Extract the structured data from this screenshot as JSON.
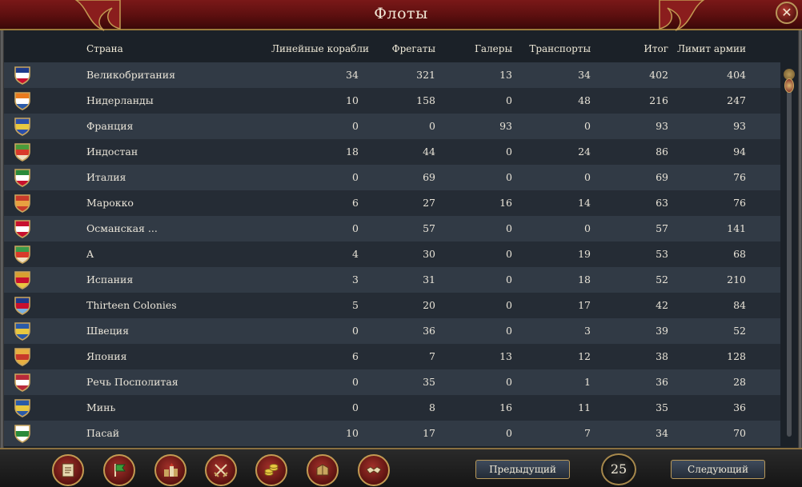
{
  "window": {
    "title": "Флоты",
    "close_label": "✕"
  },
  "header": {
    "country": "Страна",
    "line_ships": "Линейные корабли",
    "frigates": "Фрегаты",
    "galleys": "Галеры",
    "transports": "Транспорты",
    "total": "Итог",
    "army_limit": "Лимит армии"
  },
  "rows": [
    {
      "name": "Великобритания",
      "line": "34",
      "frig": "321",
      "gal": "13",
      "trans": "34",
      "total": "402",
      "limit": "404",
      "flag": [
        "#1e3a8a",
        "#ffffff",
        "#c8102e"
      ]
    },
    {
      "name": "Нидерланды",
      "line": "10",
      "frig": "158",
      "gal": "0",
      "trans": "48",
      "total": "216",
      "limit": "247",
      "flag": [
        "#e87a1e",
        "#ffffff",
        "#2a5aa8"
      ]
    },
    {
      "name": "Франция",
      "line": "0",
      "frig": "0",
      "gal": "93",
      "trans": "0",
      "total": "93",
      "limit": "93",
      "flag": [
        "#2c4fa8",
        "#e8c840",
        "#2c4fa8"
      ]
    },
    {
      "name": "Индостан",
      "line": "18",
      "frig": "44",
      "gal": "0",
      "trans": "24",
      "total": "86",
      "limit": "94",
      "flag": [
        "#4a9a3a",
        "#d83a2a",
        "#f0e0c0"
      ]
    },
    {
      "name": "Италия",
      "line": "0",
      "frig": "69",
      "gal": "0",
      "trans": "0",
      "total": "69",
      "limit": "76",
      "flag": [
        "#2a8a3a",
        "#ffffff",
        "#c8102e"
      ]
    },
    {
      "name": "Марокко",
      "line": "6",
      "frig": "27",
      "gal": "16",
      "trans": "14",
      "total": "63",
      "limit": "76",
      "flag": [
        "#c83a2a",
        "#e8a040",
        "#c83a2a"
      ]
    },
    {
      "name": "Османская ...",
      "line": "0",
      "frig": "57",
      "gal": "0",
      "trans": "0",
      "total": "57",
      "limit": "141",
      "flag": [
        "#c8102e",
        "#ffffff",
        "#c8102e"
      ]
    },
    {
      "name": "A",
      "line": "4",
      "frig": "30",
      "gal": "0",
      "trans": "19",
      "total": "53",
      "limit": "68",
      "flag": [
        "#3a9a4a",
        "#d83a2a",
        "#f0e0c0"
      ]
    },
    {
      "name": "Испания",
      "line": "3",
      "frig": "31",
      "gal": "0",
      "trans": "18",
      "total": "52",
      "limit": "210",
      "flag": [
        "#d8a030",
        "#c8102e",
        "#e8c840"
      ]
    },
    {
      "name": "Thirteen Colonies",
      "line": "5",
      "frig": "20",
      "gal": "0",
      "trans": "17",
      "total": "42",
      "limit": "84",
      "flag": [
        "#1e3a8a",
        "#c8102e",
        "#7ab0e0"
      ]
    },
    {
      "name": "Швеция",
      "line": "0",
      "frig": "36",
      "gal": "0",
      "trans": "3",
      "total": "39",
      "limit": "52",
      "flag": [
        "#2a5aa8",
        "#e8c840",
        "#2a5aa8"
      ]
    },
    {
      "name": "Япония",
      "line": "6",
      "frig": "7",
      "gal": "13",
      "trans": "12",
      "total": "38",
      "limit": "128",
      "flag": [
        "#e8b040",
        "#c83a2a",
        "#e8b040"
      ]
    },
    {
      "name": "Речь Посполитая",
      "line": "0",
      "frig": "35",
      "gal": "0",
      "trans": "1",
      "total": "36",
      "limit": "28",
      "flag": [
        "#b82a3a",
        "#ffffff",
        "#b82a3a"
      ]
    },
    {
      "name": "Минь",
      "line": "0",
      "frig": "8",
      "gal": "16",
      "trans": "11",
      "total": "35",
      "limit": "36",
      "flag": [
        "#2a5aa8",
        "#e8c840",
        "#2a5aa8"
      ]
    },
    {
      "name": "Пасай",
      "line": "10",
      "frig": "17",
      "gal": "0",
      "trans": "7",
      "total": "34",
      "limit": "70",
      "flag": [
        "#ffffff",
        "#2a8a3a",
        "#ffffff"
      ]
    }
  ],
  "footer": {
    "prev_label": "Предыдущий",
    "next_label": "Следующий",
    "page_number": "25",
    "icons": [
      "ledger-icon",
      "flag-icon",
      "buildings-icon",
      "crossed-swords-icon",
      "coins-icon",
      "trade-goods-icon",
      "handshake-icon"
    ]
  }
}
